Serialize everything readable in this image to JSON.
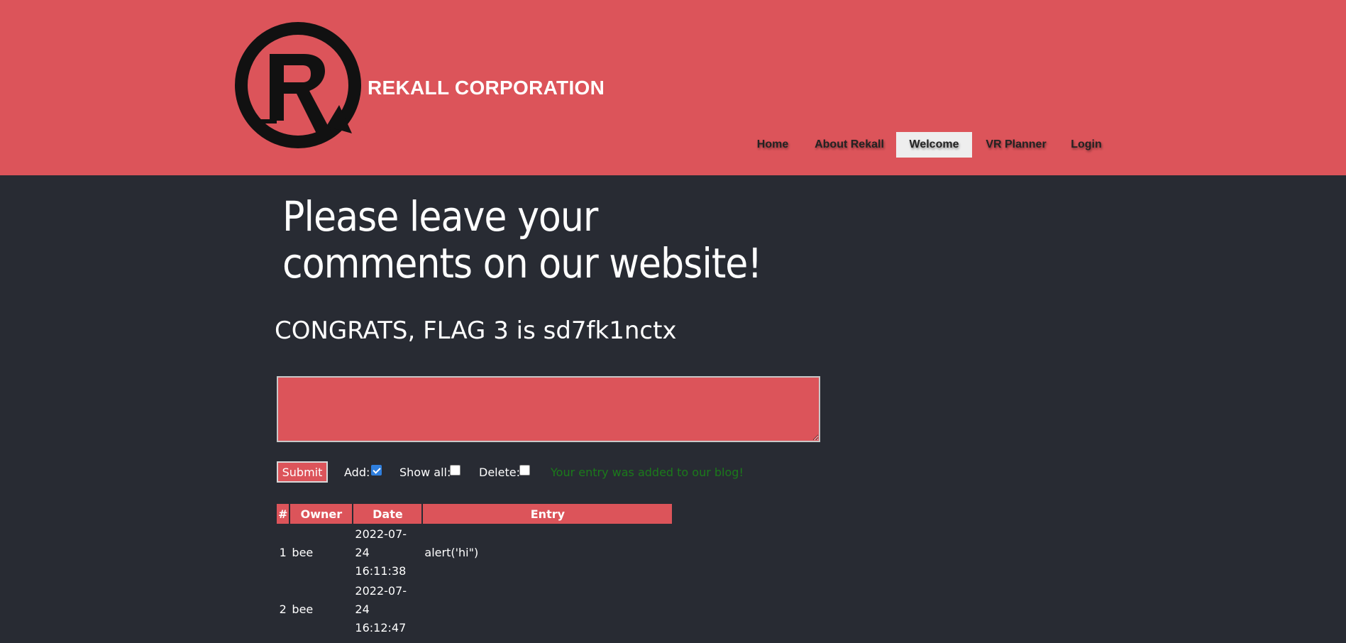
{
  "header": {
    "brand": "REKALL CORPORATION",
    "colors": {
      "background": "#dc545a",
      "active_tab": "#eeeeee"
    },
    "logo_icon": "rekall-r-logo"
  },
  "nav": {
    "items": [
      {
        "label": "Home",
        "active": false
      },
      {
        "label": "About Rekall",
        "active": false
      },
      {
        "label": "Welcome",
        "active": true
      },
      {
        "label": "VR Planner",
        "active": false
      },
      {
        "label": "Login",
        "active": false
      }
    ]
  },
  "main": {
    "title_line1": "Please leave your",
    "title_line2": "comments on our website!",
    "flag_message": "CONGRATS, FLAG 3 is sd7fk1nctx",
    "comment_value": ""
  },
  "controls": {
    "submit_label": "Submit",
    "add_label": "Add:",
    "add_checked": true,
    "show_all_label": "Show all:",
    "show_all_checked": false,
    "delete_label": "Delete:",
    "delete_checked": false,
    "status_message": "Your entry was added to our blog!"
  },
  "table": {
    "headers": [
      "#",
      "Owner",
      "Date",
      "Entry"
    ],
    "rows": [
      {
        "num": "1",
        "owner": "bee",
        "date_line1": "2022-07-24",
        "date_line2": "16:11:38",
        "entry": "alert('hi\")"
      },
      {
        "num": "2",
        "owner": "bee",
        "date_line1": "2022-07-24",
        "date_line2": "16:12:47",
        "entry": ""
      }
    ]
  },
  "colors": {
    "page_background": "#282b33",
    "accent": "#dc545a",
    "success": "#1b7a1b"
  }
}
